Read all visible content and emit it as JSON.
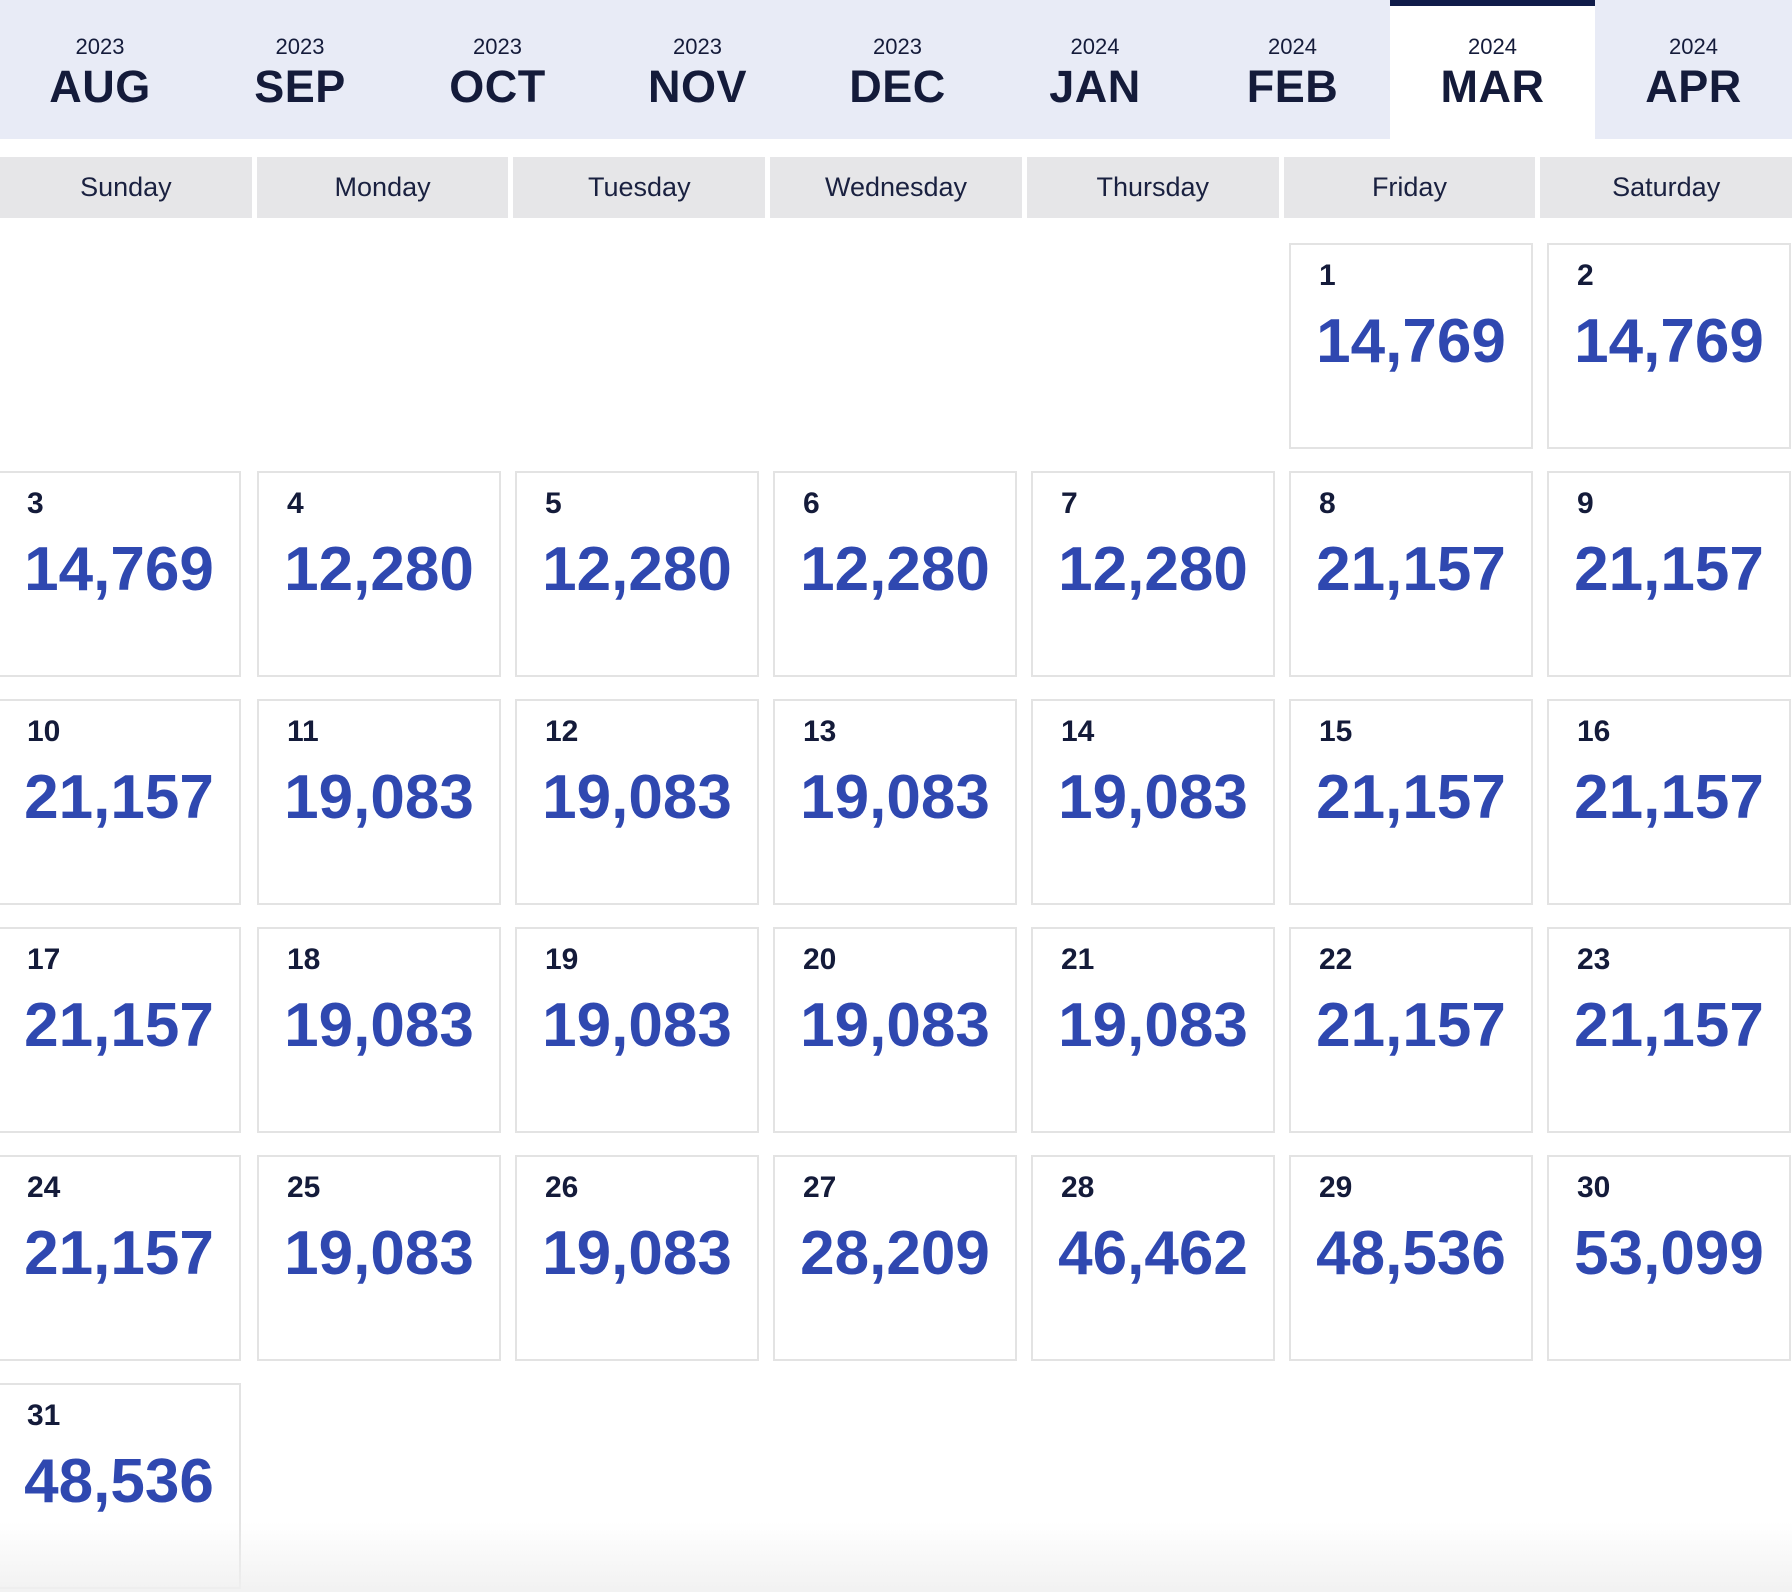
{
  "month_tabs": [
    {
      "year": "2023",
      "month": "AUG",
      "active": false
    },
    {
      "year": "2023",
      "month": "SEP",
      "active": false
    },
    {
      "year": "2023",
      "month": "OCT",
      "active": false
    },
    {
      "year": "2023",
      "month": "NOV",
      "active": false
    },
    {
      "year": "2023",
      "month": "DEC",
      "active": false
    },
    {
      "year": "2024",
      "month": "JAN",
      "active": false
    },
    {
      "year": "2024",
      "month": "FEB",
      "active": false
    },
    {
      "year": "2024",
      "month": "MAR",
      "active": true
    },
    {
      "year": "2024",
      "month": "APR",
      "active": false
    }
  ],
  "weekdays": [
    "Sunday",
    "Monday",
    "Tuesday",
    "Wednesday",
    "Thursday",
    "Friday",
    "Saturday"
  ],
  "first_weekday_index": 5,
  "days": [
    {
      "day": "1",
      "price": "14,769"
    },
    {
      "day": "2",
      "price": "14,769"
    },
    {
      "day": "3",
      "price": "14,769"
    },
    {
      "day": "4",
      "price": "12,280"
    },
    {
      "day": "5",
      "price": "12,280"
    },
    {
      "day": "6",
      "price": "12,280"
    },
    {
      "day": "7",
      "price": "12,280"
    },
    {
      "day": "8",
      "price": "21,157"
    },
    {
      "day": "9",
      "price": "21,157"
    },
    {
      "day": "10",
      "price": "21,157"
    },
    {
      "day": "11",
      "price": "19,083"
    },
    {
      "day": "12",
      "price": "19,083"
    },
    {
      "day": "13",
      "price": "19,083"
    },
    {
      "day": "14",
      "price": "19,083"
    },
    {
      "day": "15",
      "price": "21,157"
    },
    {
      "day": "16",
      "price": "21,157"
    },
    {
      "day": "17",
      "price": "21,157"
    },
    {
      "day": "18",
      "price": "19,083"
    },
    {
      "day": "19",
      "price": "19,083"
    },
    {
      "day": "20",
      "price": "19,083"
    },
    {
      "day": "21",
      "price": "19,083"
    },
    {
      "day": "22",
      "price": "21,157"
    },
    {
      "day": "23",
      "price": "21,157"
    },
    {
      "day": "24",
      "price": "21,157"
    },
    {
      "day": "25",
      "price": "19,083"
    },
    {
      "day": "26",
      "price": "19,083"
    },
    {
      "day": "27",
      "price": "28,209"
    },
    {
      "day": "28",
      "price": "46,462"
    },
    {
      "day": "29",
      "price": "48,536"
    },
    {
      "day": "30",
      "price": "53,099"
    },
    {
      "day": "31",
      "price": "48,536"
    }
  ],
  "colors": {
    "tab_bar_bg": "#e8ebf6",
    "active_tab_bg": "#ffffff",
    "active_tab_border": "#101c4a",
    "weekday_bg": "#e6e6e8",
    "price_text": "#2f48b0",
    "day_text": "#141b3a"
  }
}
